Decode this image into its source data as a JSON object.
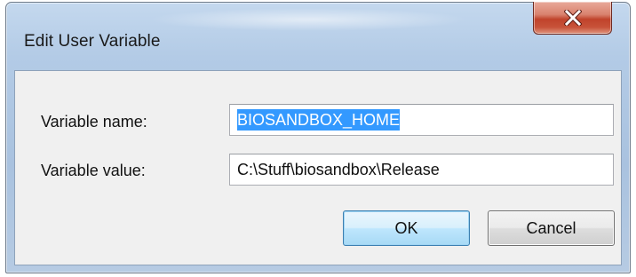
{
  "dialog": {
    "title": "Edit User Variable",
    "close_icon": "close-icon"
  },
  "fields": {
    "name_label": "Variable name:",
    "name_value": "BIOSANDBOX_HOME",
    "name_selected": true,
    "value_label": "Variable value:",
    "value_value": "C:\\Stuff\\biosandbox\\Release"
  },
  "buttons": {
    "ok_label": "OK",
    "cancel_label": "Cancel"
  },
  "colors": {
    "close_button": "#c8533a",
    "selection": "#3399ff",
    "ok_border": "#3c7fb1"
  }
}
